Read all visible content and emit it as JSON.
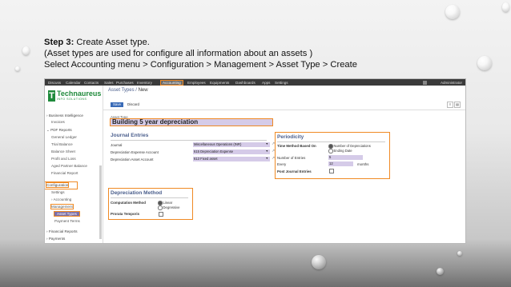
{
  "slide": {
    "step_label": "Step 3:",
    "step_text": " Create Asset type.",
    "line2": "(Asset types are used for configure all information about an assets )",
    "line3": "Select Accounting menu > Configuration > Management > Asset Type > Create"
  },
  "topbar": {
    "menus": [
      "Discuss",
      "Calendar",
      "Contacts",
      "Sales",
      "Purchases",
      "Inventory",
      "Accounting",
      "Employees",
      "Equipments",
      "Dashboards",
      "Apps",
      "Settings"
    ],
    "user": "Administrator"
  },
  "logo": {
    "name": "Technaureus",
    "sub": "INFO SOLUTIONS"
  },
  "sidebar": {
    "business_intelligence": "Business Intelligence",
    "invoices": "Invoices",
    "pdf_reports": "PDF Reports",
    "general_ledger": "General Ledger",
    "trial_balance": "Trial Balance",
    "balance_sheet": "Balance Sheet",
    "profit_loss": "Profit and Loss",
    "aged_partner": "Aged Partner Balance",
    "financial_report": "Financial Report",
    "configuration": "Configuration",
    "settings": "Settings",
    "accounting": "Accounting",
    "management": "Management",
    "asset_types": "Asset Types",
    "payment_terms": "Payment Terms",
    "financial_reports": "Financial Reports",
    "payments": "Payments"
  },
  "breadcrumb": {
    "parent": "Asset Types",
    "current": "New"
  },
  "buttons": {
    "save": "Save",
    "discard": "Discard"
  },
  "form": {
    "asset_type_label": "Asset Type",
    "asset_type_value": "Building 5 year depreciation",
    "journal_entries": {
      "title": "Journal Entries",
      "journal_label": "Journal",
      "journal_value": "Miscellaneous Operations (INR)",
      "dep_expense_label": "Depreciation Expense Account",
      "dep_expense_value": "615 Depreciation Expense",
      "dep_asset_label": "Depreciation Asset Account",
      "dep_asset_value": "613 Fixed asset"
    },
    "periodicity": {
      "title": "Periodicity",
      "time_method_label": "Time Method Based On",
      "opt_number": "Number of Depreciations",
      "opt_end": "Ending Date",
      "num_entries_label": "Number of Entries",
      "num_entries_value": "5",
      "every_label": "Every",
      "every_value": "12",
      "every_unit": "months",
      "post_label": "Post Journal Entries"
    },
    "depreciation_method": {
      "title": "Depreciation Method",
      "computation_label": "Computation Method",
      "opt_linear": "Linear",
      "opt_degressive": "Degressive",
      "prorata_label": "Prorata Temporis"
    }
  },
  "colors": {
    "accent": "#f08a24",
    "field": "#d5cbe8",
    "primary": "#3a6bb7",
    "brand": "#1f8a3b"
  }
}
